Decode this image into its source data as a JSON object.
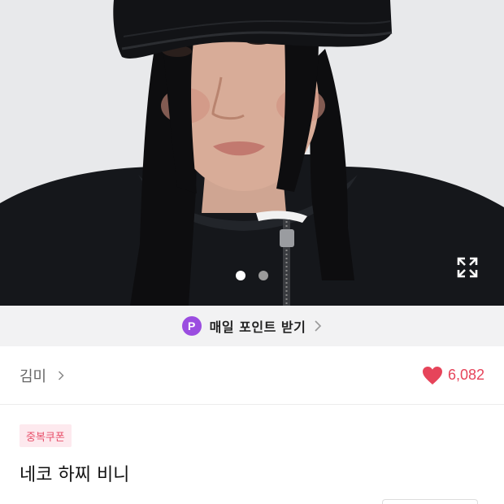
{
  "gallery": {
    "image_alt": "model wearing black knit beanie and black zip hoodie",
    "slide_count": 2,
    "active_slide": 1,
    "expand_icon": "expand-icon"
  },
  "points_banner": {
    "badge": "P",
    "label": "매일 포인트 받기",
    "icon": "chevron-right-icon"
  },
  "seller": {
    "name": "김미",
    "icon": "chevron-right-icon"
  },
  "likes": {
    "count": "6,082",
    "icon": "heart-icon"
  },
  "product": {
    "coupon_badge": "중복쿠폰",
    "title": "네코 하찌 비니"
  },
  "colors": {
    "accent_pink": "#e6445a",
    "points_purple": "#9b4de0",
    "coupon_bg": "#fde9ee"
  }
}
